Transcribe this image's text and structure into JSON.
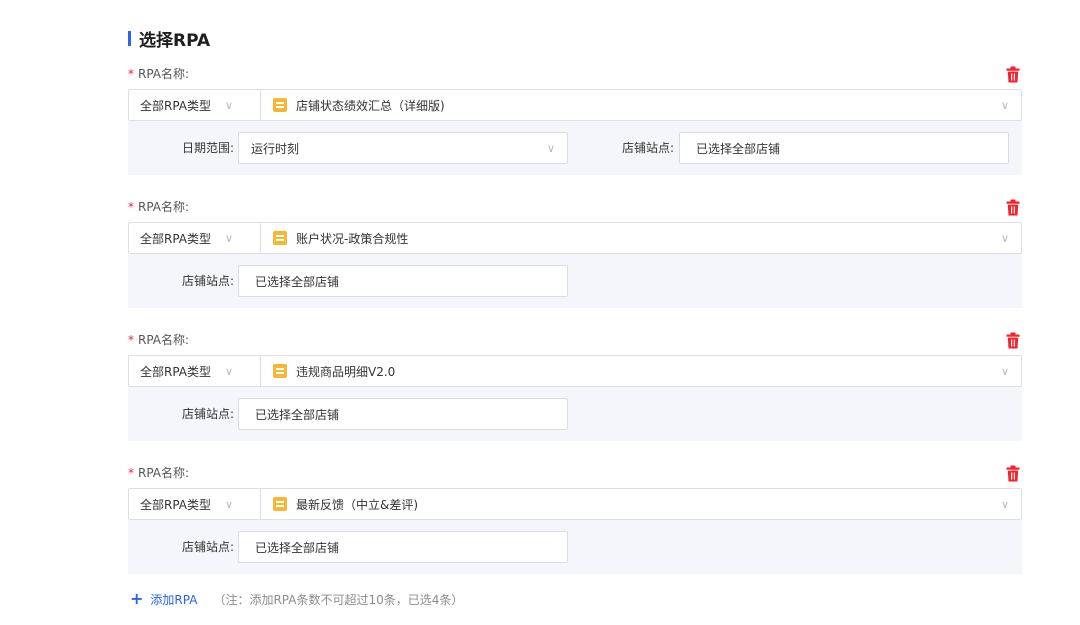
{
  "section": {
    "title": "选择RPA"
  },
  "rpa_items": [
    {
      "label_star": "*",
      "label": "RPA名称:",
      "type_value": "全部RPA类型",
      "name_value": "店铺状态绩效汇总（详细版)",
      "params": [
        {
          "label": "日期范围:",
          "value": "运行时刻",
          "dropdown": true
        },
        {
          "label": "店铺站点:",
          "value": "已选择全部店铺",
          "dropdown": false
        }
      ]
    },
    {
      "label_star": "*",
      "label": "RPA名称:",
      "type_value": "全部RPA类型",
      "name_value": "账户状况-政策合规性",
      "params": [
        {
          "label": "店铺站点:",
          "value": "已选择全部店铺",
          "dropdown": false
        }
      ]
    },
    {
      "label_star": "*",
      "label": "RPA名称:",
      "type_value": "全部RPA类型",
      "name_value": "违规商品明细V2.0",
      "params": [
        {
          "label": "店铺站点:",
          "value": "已选择全部店铺",
          "dropdown": false
        }
      ]
    },
    {
      "label_star": "*",
      "label": "RPA名称:",
      "type_value": "全部RPA类型",
      "name_value": "最新反馈（中立&差评)",
      "params": [
        {
          "label": "店铺站点:",
          "value": "已选择全部店铺",
          "dropdown": false
        }
      ]
    }
  ],
  "footer": {
    "add_label": "添加RPA",
    "note": "（注：添加RPA条数不可超过10条，已选4条）"
  },
  "colors": {
    "accent": "#2a62f6",
    "danger": "#f5222d",
    "rpa_icon": "#f7b733",
    "param_bg": "#f4f6fb"
  },
  "icons": {
    "trash": "trash-icon",
    "chevron": "chevron-down-icon",
    "rpa": "rpa-doc-icon",
    "add": "plus-icon"
  }
}
